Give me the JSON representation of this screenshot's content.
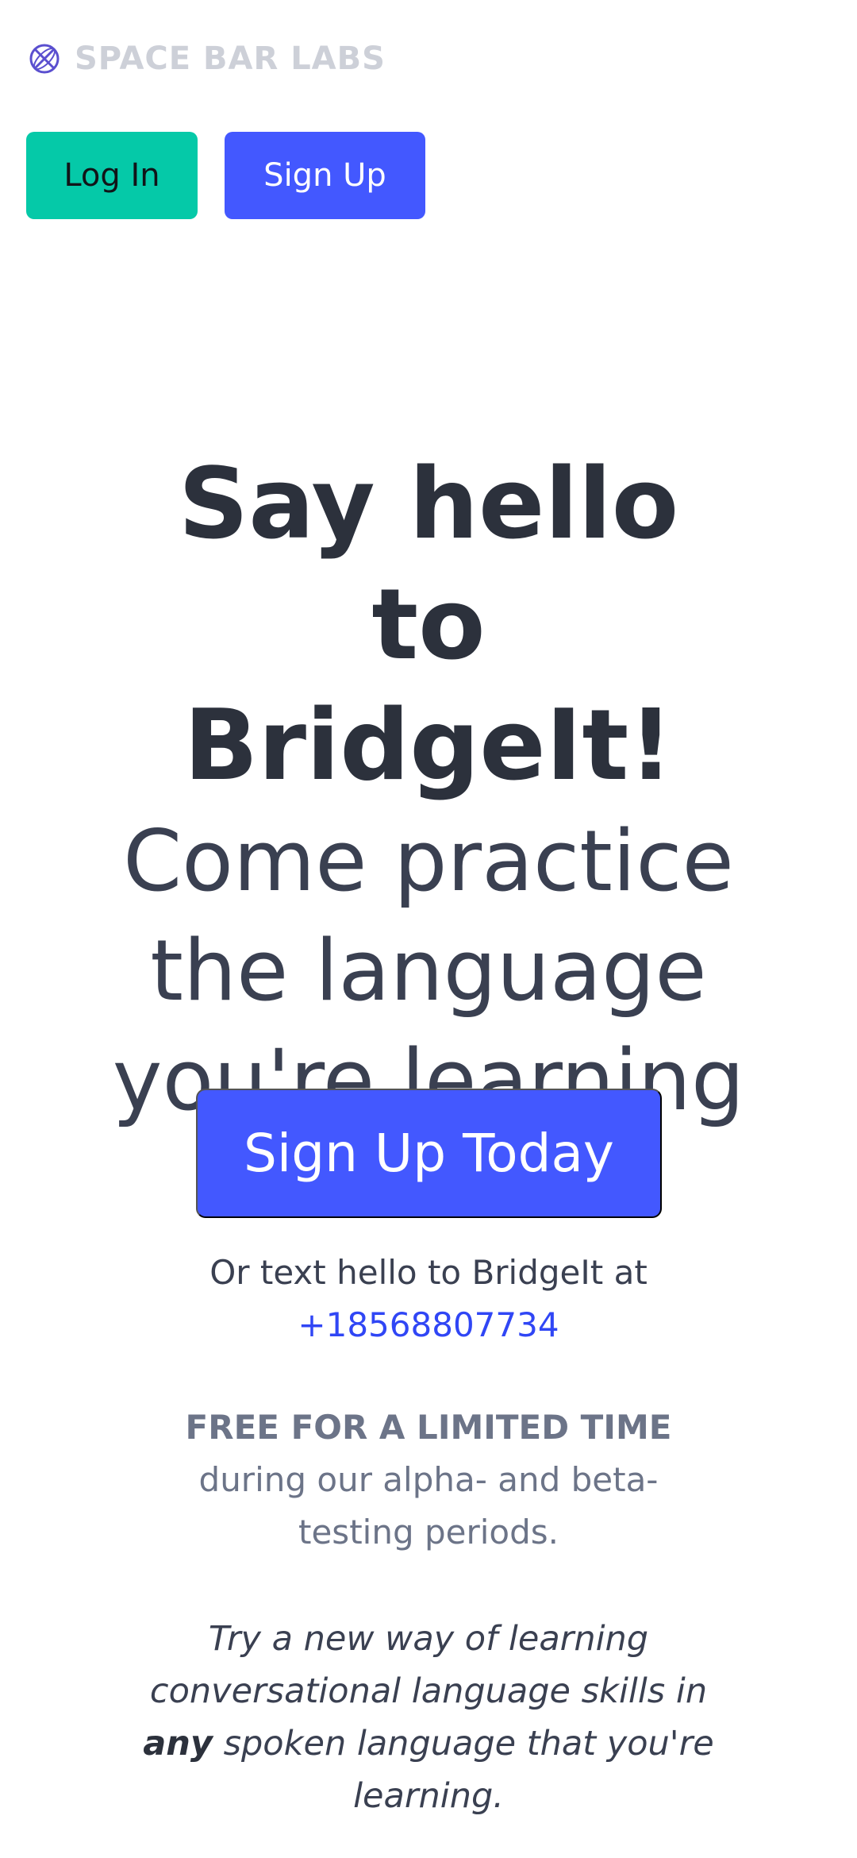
{
  "header": {
    "brand_name": "SPACE BAR LABS",
    "brand_icon": "globe-icon",
    "login_label": "Log In",
    "signup_label": "Sign Up"
  },
  "hero": {
    "title_line1": "Say hello to",
    "title_line2": "BridgeIt!",
    "subtitle_line1": "Come practice",
    "subtitle_line2": "the language",
    "subtitle_line3": "you're learning"
  },
  "cta": {
    "label": "Sign Up Today"
  },
  "contact": {
    "text": "Or text hello to BridgeIt at",
    "phone": "+18568807734"
  },
  "promo": {
    "headline": "FREE FOR A LIMITED TIME",
    "line1": "during our alpha- and beta-",
    "line2": "testing periods."
  },
  "tagline": {
    "line1": "Try a new way of learning",
    "line2": "conversational language skills in",
    "emphasis": "any",
    "line3_rest": " spoken language that you're",
    "line4": "learning."
  },
  "colors": {
    "accent_blue": "#4358ff",
    "accent_teal": "#05c9a8",
    "link_blue": "#3046f5",
    "brand_icon_purple": "#5a4fcf"
  }
}
